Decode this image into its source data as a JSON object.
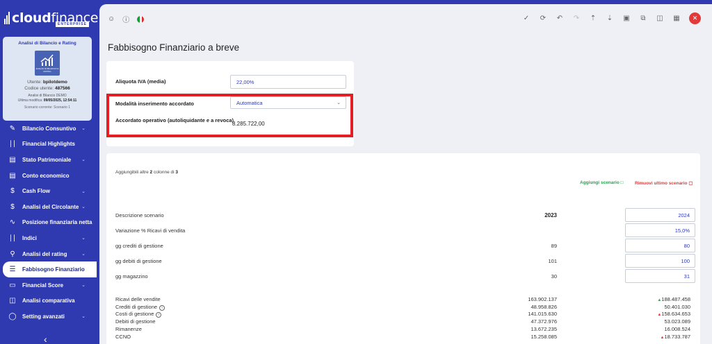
{
  "brand": {
    "name_bold": "cloud",
    "name_light": "finance",
    "sub": "ENTERPRISE"
  },
  "profile": {
    "title": "Analisi di Bilancio e Rating",
    "logo_caption": "ANALISI DI BILANCIO E RATING",
    "user_label": "Utente:",
    "user": "bpilotdemo",
    "code_label": "Codice utente:",
    "code": "487566",
    "company": "Analisi di Bilancio DEMO",
    "modified_label": "Ultima modifica:",
    "modified": "09/05/2025, 12:54:11",
    "scenario": "Scenario corrente: Scenario 1"
  },
  "nav": [
    {
      "label": "Bilancio Consuntivo",
      "icon": "edit-chart-icon",
      "chevron": true
    },
    {
      "label": "Financial Highlights",
      "icon": "bar-chart-icon",
      "chevron": false
    },
    {
      "label": "Stato Patrimoniale",
      "icon": "document-icon",
      "chevron": true
    },
    {
      "label": "Conto economico",
      "icon": "document-icon",
      "chevron": false
    },
    {
      "label": "Cash Flow",
      "icon": "dollar-icon",
      "chevron": true
    },
    {
      "label": "Analisi del Circolante",
      "icon": "dollar-icon",
      "chevron": true
    },
    {
      "label": "Posizione finanziaria netta",
      "icon": "trend-icon",
      "chevron": false
    },
    {
      "label": "Indici",
      "icon": "bar-chart-icon",
      "chevron": true
    },
    {
      "label": "Analisi del rating",
      "icon": "award-icon",
      "chevron": true
    },
    {
      "label": "Fabbisogno Finanziario",
      "icon": "sliders-icon",
      "chevron": false,
      "active": true
    },
    {
      "label": "Financial Score",
      "icon": "monitor-icon",
      "chevron": true
    },
    {
      "label": "Analisi comparativa",
      "icon": "columns-icon",
      "chevron": false
    },
    {
      "label": "Setting avanzati",
      "icon": "toggle-icon",
      "chevron": true
    }
  ],
  "page_title": "Fabbisogno Finanziario a breve",
  "form": {
    "iva_label": "Aliquota IVA (media)",
    "iva_value": "22,00%",
    "mode_label": "Modalità inserimento accordato",
    "mode_value": "Automatica",
    "accordato_label": "Accordato operativo (autoliquidante e a revoca)",
    "accordato_value": "8.285.722,00"
  },
  "scenario": {
    "hint_pre": "Aggiungibili altre ",
    "hint_n": "2",
    "hint_mid": " colonne di ",
    "hint_total": "3",
    "add_label": "Aggiungi scenario",
    "remove_label": "Rimuovi ultimo scenario"
  },
  "inputs_table": {
    "header": {
      "label": "Descrizione scenario",
      "c1": "2023",
      "c2": "2024"
    },
    "rows": [
      {
        "label": "Variazione % Ricavi di vendita",
        "c1": "",
        "c2": "15,0%"
      },
      {
        "label": "gg crediti di gestione",
        "c1": "89",
        "c2": "80"
      },
      {
        "label": "gg debiti di gestione",
        "c1": "101",
        "c2": "100"
      },
      {
        "label": "gg magazzino",
        "c1": "30",
        "c2": "31"
      }
    ]
  },
  "results_table": [
    {
      "label": "Ricavi delle vendite",
      "info": false,
      "c1": "163.902.137",
      "c2": "188.487.458",
      "trend": "up"
    },
    {
      "label": "Crediti di gestione",
      "info": true,
      "c1": "48.958.826",
      "c2": "50.401.030",
      "trend": ""
    },
    {
      "label": "Costi di gestione",
      "info": true,
      "c1": "141.015.630",
      "c2": "158.634.653",
      "trend": "down"
    },
    {
      "label": "Debiti di gestione",
      "info": false,
      "c1": "47.372.976",
      "c2": "53.023.089",
      "trend": ""
    },
    {
      "label": "Rimanenze",
      "info": false,
      "c1": "13.672.235",
      "c2": "16.008.524",
      "trend": ""
    },
    {
      "label": "CCNO",
      "info": false,
      "c1": "15.258.085",
      "c2": "18.733.787",
      "trend": "down"
    }
  ],
  "colors": {
    "sidebar": "#2f3ab0",
    "accent_red": "#e31e24",
    "positive": "#1fa84a",
    "negative": "#e23a3a"
  }
}
